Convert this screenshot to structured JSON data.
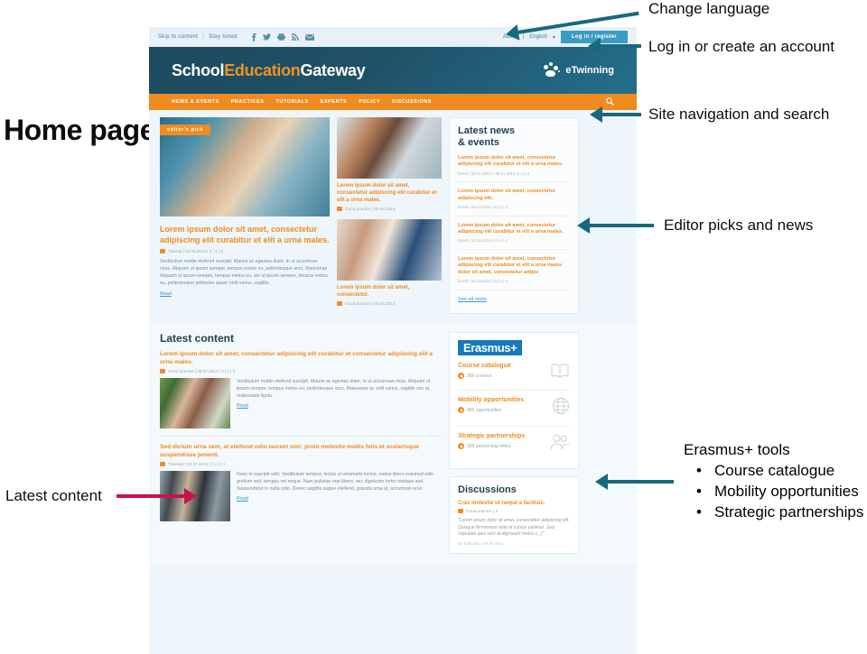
{
  "annotations": {
    "home_page": "Home page",
    "change_language": "Change language",
    "login_create": "Log in or create an account",
    "site_nav_search": "Site navigation and search",
    "editor_picks": "Editor picks and news",
    "latest_content": "Latest content",
    "erasmus_tools_title": "Erasmus+ tools",
    "erasmus_tools_items": [
      "Course catalogue",
      "Mobility opportunities",
      "Strategic partnerships"
    ]
  },
  "colors": {
    "teal_arrow": "#17697f",
    "crimson_arrow": "#c8134b",
    "brand_orange": "#ef8b20",
    "brand_dark_blue": "#1d4a5f",
    "link_blue": "#3a9cc4",
    "erasmus_blue": "#1479bd"
  },
  "site": {
    "topbar": {
      "skip_to_content": "Skip to content",
      "separator": "|",
      "stay_tuned": "Stay tuned",
      "social": [
        "facebook-icon",
        "twitter-icon",
        "print-icon",
        "rss-icon",
        "email-icon"
      ],
      "about": "About",
      "language": "English",
      "language_caret": "▾",
      "login_button": "Log in / register"
    },
    "logo": {
      "part1": "School",
      "part2": "Education",
      "part3": "Gateway"
    },
    "partner_logo": {
      "name": "eTwinning",
      "mark": "etwinning-logo-icon"
    },
    "nav": {
      "items": [
        "NEWS & EVENTS",
        "PRACTICES",
        "TUTORIALS",
        "EXPERTS",
        "POLICY",
        "DISCUSSIONS"
      ],
      "search_icon": "search-icon"
    },
    "hero": {
      "badge": "editor's pick",
      "title": "Lorem ipsum dolor sit amet, consectetur adipiscing elit curabitur et elit a urna males.",
      "meta": "Tutorial | 03.06.2014 | 3 | 4 | 4",
      "body": "Vestibulum mattis eleifend suscipit. Mauris ac egestas diam. In ut accumsan risus. Aliquam ut ipsum semper, tempus metus eu, pellentesque arcu. Maecenas Aliquam ut ipsum semper, tempus metus eu, am ut ipsum semper, tempus metus eu, pellentesque pellentes quasc velit varius, sagittis.",
      "read": "Read"
    },
    "mid_cards": [
      {
        "title": "Lorem ipsum dolor sit amet, consectetur adipiscing elit curabitur et elit a urna males.",
        "meta": "Good practice | 03.06.2014"
      },
      {
        "title": "Lorem ipsum dolor sit amet, consectetur.",
        "meta": "Good practice | 03.06.2014"
      }
    ],
    "latest_news": {
      "heading_line1": "Latest news",
      "heading_line2": "& events",
      "items": [
        {
          "title": "Lorem ipsum dolor sit amet, consectetur adipiscing elit curabitur et elit a urna males.",
          "meta": "Event | 28.11.2014 > 08.01.2015   3 | 4 | 4"
        },
        {
          "title": "Lorem ipsum dolor sit amet, consectetur adipiscing elit.",
          "meta": "Event | 18.12.2014 | 3 | 4 | 4"
        },
        {
          "title": "Lorem ipsum dolor sit amet, consectetur adipiscing elit curabitur et elit a urna males.",
          "meta": "Event | 18.12.2014 | 3 | 4 | 4"
        },
        {
          "title": "Lorem ipsum dolor sit amet, consectetur adipiscing elit curabitur et elit a urna males dolor sit amet, consectetur adipis",
          "meta": "Event | 18.12.2014 | 3 | 4 | 4"
        }
      ],
      "see_all": "See all news"
    },
    "latest_content": {
      "heading": "Latest content",
      "items": [
        {
          "title": "Lorem ipsum dolor sit amet, consectetur adipiscing elit curabitur et consectetur adipiscing elit a urna males.",
          "meta": "Good practice | 08.07.2014 | 3 | 4 | 4",
          "body": "Vestibulum mattis eleifend suscipit. Mauris ac egestas diam. In ut accumsan risus. Aliquam ut ipsum semper, tempus metus eu, pellentesque arcu. Maecenas ac velit varius, sagittis orci at, malesuada ligula.",
          "read": "Read"
        },
        {
          "title": "Sed dictum urna sem, at eleifend odio laoreet non: proin molestie mollis felis et scelerisque suspendisse potenti.",
          "meta": "Tutorials | 04.07.2014 | 3 | 4 | 4",
          "body": "Nunc in suscipit velit. Vestibulum tempus, lectus ut venenatis luctus, metus libero euismod odio pretium sed, tempus vel neque. Nam pulvinar erat libero, nec dignissim tortor tristique sed. Suspendisse in nulla odio. Donec sagittis augue eleifend, gravida urna at, accumsan eros.",
          "read": "Read"
        }
      ]
    },
    "erasmus": {
      "logo": "Erasmus+",
      "rows": [
        {
          "title": "Course catalogue",
          "sub": "999 courses",
          "icon": "book-icon"
        },
        {
          "title": "Mobility opportunities",
          "sub": "999 opportunities",
          "icon": "globe-icon"
        },
        {
          "title": "Strategic partnerships",
          "sub": "999 partnership offers",
          "icon": "people-icon"
        }
      ]
    },
    "discussions": {
      "heading": "Discussions",
      "title": "Cras molestie ut neque a facilisis.",
      "meta": "Good practice | 3",
      "quote": "\"Lorem ipsum dolor sit amet, consectetur adipiscing elit. Quisque fermentum ante id cursus pulvinar. Sed vulputate quis sem at dignissim metus (...)\"",
      "by": "by John Doe | 09.07.2014"
    }
  }
}
